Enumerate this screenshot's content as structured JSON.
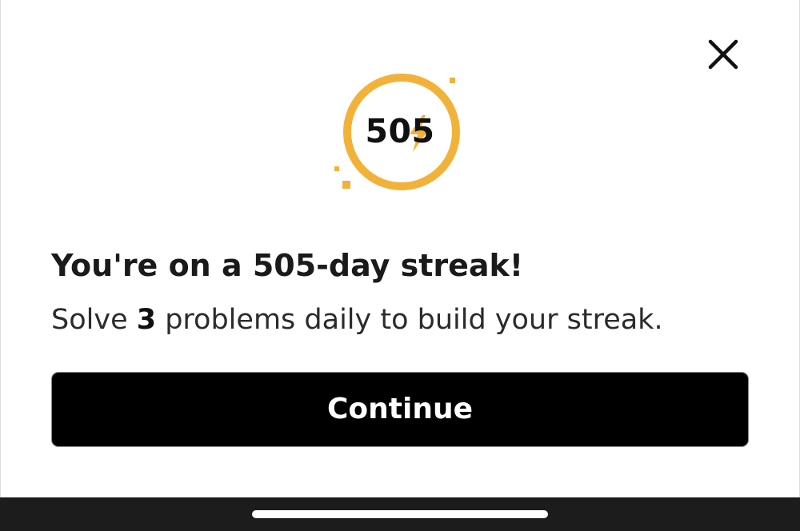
{
  "dialog": {
    "close_icon": "close-icon",
    "streak_count": "505",
    "headline": "You're on a 505-day streak!",
    "subline_prefix": "Solve ",
    "subline_number": "3",
    "subline_suffix": " problems daily to build your streak.",
    "continue_label": "Continue"
  },
  "badge": {
    "icon": "lightning-bolt-icon",
    "ring_color": "#F2B23A",
    "bolt_color": "#F2B23A"
  },
  "colors": {
    "button_background": "#000000",
    "button_text": "#ffffff",
    "system_bar": "#1c1c1c"
  }
}
